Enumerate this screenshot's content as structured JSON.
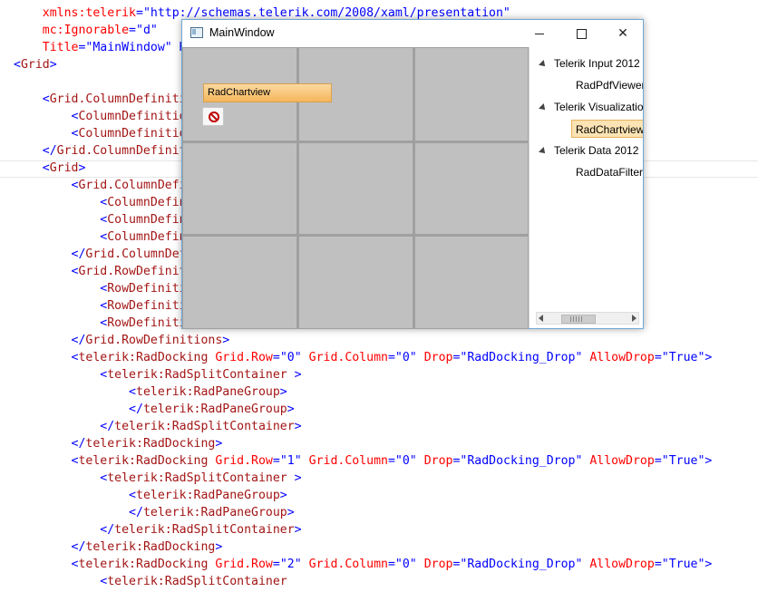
{
  "code_lines": [
    [
      {
        "t": "    "
      },
      {
        "c": "attr",
        "t": "xmlns:telerik"
      },
      {
        "c": "punc",
        "t": "="
      },
      {
        "c": "val",
        "t": "\"http://schemas.telerik.com/2008/xaml/presentation\""
      }
    ],
    [
      {
        "t": "    "
      },
      {
        "c": "attr",
        "t": "mc:Ignorable"
      },
      {
        "c": "punc",
        "t": "="
      },
      {
        "c": "val",
        "t": "\"d\""
      }
    ],
    [
      {
        "t": "    "
      },
      {
        "c": "attr",
        "t": "Title"
      },
      {
        "c": "punc",
        "t": "="
      },
      {
        "c": "val",
        "t": "\"MainWindow\" H"
      }
    ],
    [
      {
        "c": "punc",
        "t": "<"
      },
      {
        "c": "tag",
        "t": "Grid"
      },
      {
        "c": "punc",
        "t": ">"
      }
    ],
    [
      {
        "t": ""
      }
    ],
    [
      {
        "t": "    "
      },
      {
        "c": "punc",
        "t": "<"
      },
      {
        "c": "tag",
        "t": "Grid.ColumnDefinitions>"
      }
    ],
    [
      {
        "t": "        "
      },
      {
        "c": "punc",
        "t": "<"
      },
      {
        "c": "tag",
        "t": "ColumnDefinition"
      }
    ],
    [
      {
        "t": "        "
      },
      {
        "c": "punc",
        "t": "<"
      },
      {
        "c": "tag",
        "t": "ColumnDefinition"
      }
    ],
    [
      {
        "t": "    "
      },
      {
        "c": "punc",
        "t": "</"
      },
      {
        "c": "tag",
        "t": "Grid.ColumnDefinitions>"
      }
    ],
    [
      {
        "t": "    "
      },
      {
        "c": "punc",
        "t": "<"
      },
      {
        "c": "tag",
        "t": "Grid"
      },
      {
        "c": "punc",
        "t": ">"
      }
    ],
    [
      {
        "t": "        "
      },
      {
        "c": "punc",
        "t": "<"
      },
      {
        "c": "tag",
        "t": "Grid.ColumnDefinitions"
      }
    ],
    [
      {
        "t": "            "
      },
      {
        "c": "punc",
        "t": "<"
      },
      {
        "c": "tag",
        "t": "ColumnDefinition"
      }
    ],
    [
      {
        "t": "            "
      },
      {
        "c": "punc",
        "t": "<"
      },
      {
        "c": "tag",
        "t": "ColumnDefinition"
      }
    ],
    [
      {
        "t": "            "
      },
      {
        "c": "punc",
        "t": "<"
      },
      {
        "c": "tag",
        "t": "ColumnDefinition"
      }
    ],
    [
      {
        "t": "        "
      },
      {
        "c": "punc",
        "t": "</"
      },
      {
        "c": "tag",
        "t": "Grid.ColumnDefinitions"
      }
    ],
    [
      {
        "t": "        "
      },
      {
        "c": "punc",
        "t": "<"
      },
      {
        "c": "tag",
        "t": "Grid.RowDefinitions"
      }
    ],
    [
      {
        "t": "            "
      },
      {
        "c": "punc",
        "t": "<"
      },
      {
        "c": "tag",
        "t": "RowDefinition"
      }
    ],
    [
      {
        "t": "            "
      },
      {
        "c": "punc",
        "t": "<"
      },
      {
        "c": "tag",
        "t": "RowDefinition"
      }
    ],
    [
      {
        "t": "            "
      },
      {
        "c": "punc",
        "t": "<"
      },
      {
        "c": "tag",
        "t": "RowDefinition"
      }
    ],
    [
      {
        "t": "        "
      },
      {
        "c": "punc",
        "t": "</"
      },
      {
        "c": "tag",
        "t": "Grid.RowDefinitions"
      },
      {
        "c": "punc",
        "t": ">"
      }
    ],
    [
      {
        "t": "        "
      },
      {
        "c": "punc",
        "t": "<"
      },
      {
        "c": "tag",
        "t": "telerik:RadDocking"
      },
      {
        "t": " "
      },
      {
        "c": "attr",
        "t": "Grid.Row"
      },
      {
        "c": "punc",
        "t": "="
      },
      {
        "c": "val",
        "t": "\"0\""
      },
      {
        "t": " "
      },
      {
        "c": "attr",
        "t": "Grid.Column"
      },
      {
        "c": "punc",
        "t": "="
      },
      {
        "c": "val",
        "t": "\"0\""
      },
      {
        "t": " "
      },
      {
        "c": "attr",
        "t": "Drop"
      },
      {
        "c": "punc",
        "t": "="
      },
      {
        "c": "val",
        "t": "\"RadDocking_Drop\""
      },
      {
        "t": " "
      },
      {
        "c": "attr",
        "t": "AllowDrop"
      },
      {
        "c": "punc",
        "t": "="
      },
      {
        "c": "val",
        "t": "\"True\""
      },
      {
        "c": "punc",
        "t": ">"
      }
    ],
    [
      {
        "t": "            "
      },
      {
        "c": "punc",
        "t": "<"
      },
      {
        "c": "tag",
        "t": "telerik:RadSplitContainer"
      },
      {
        "c": "punc",
        "t": " >"
      }
    ],
    [
      {
        "t": "                "
      },
      {
        "c": "punc",
        "t": "<"
      },
      {
        "c": "tag",
        "t": "telerik:RadPaneGroup"
      },
      {
        "c": "punc",
        "t": ">"
      }
    ],
    [
      {
        "t": "                "
      },
      {
        "c": "punc",
        "t": "</"
      },
      {
        "c": "tag",
        "t": "telerik:RadPaneGroup"
      },
      {
        "c": "punc",
        "t": ">"
      }
    ],
    [
      {
        "t": "            "
      },
      {
        "c": "punc",
        "t": "</"
      },
      {
        "c": "tag",
        "t": "telerik:RadSplitContainer"
      },
      {
        "c": "punc",
        "t": ">"
      }
    ],
    [
      {
        "t": "        "
      },
      {
        "c": "punc",
        "t": "</"
      },
      {
        "c": "tag",
        "t": "telerik:RadDocking"
      },
      {
        "c": "punc",
        "t": ">"
      }
    ],
    [
      {
        "t": "        "
      },
      {
        "c": "punc",
        "t": "<"
      },
      {
        "c": "tag",
        "t": "telerik:RadDocking"
      },
      {
        "t": " "
      },
      {
        "c": "attr",
        "t": "Grid.Row"
      },
      {
        "c": "punc",
        "t": "="
      },
      {
        "c": "val",
        "t": "\"1\""
      },
      {
        "t": " "
      },
      {
        "c": "attr",
        "t": "Grid.Column"
      },
      {
        "c": "punc",
        "t": "="
      },
      {
        "c": "val",
        "t": "\"0\""
      },
      {
        "t": " "
      },
      {
        "c": "attr",
        "t": "Drop"
      },
      {
        "c": "punc",
        "t": "="
      },
      {
        "c": "val",
        "t": "\"RadDocking_Drop\""
      },
      {
        "t": " "
      },
      {
        "c": "attr",
        "t": "AllowDrop"
      },
      {
        "c": "punc",
        "t": "="
      },
      {
        "c": "val",
        "t": "\"True\""
      },
      {
        "c": "punc",
        "t": ">"
      }
    ],
    [
      {
        "t": "            "
      },
      {
        "c": "punc",
        "t": "<"
      },
      {
        "c": "tag",
        "t": "telerik:RadSplitContainer"
      },
      {
        "c": "punc",
        "t": " >"
      }
    ],
    [
      {
        "t": "                "
      },
      {
        "c": "punc",
        "t": "<"
      },
      {
        "c": "tag",
        "t": "telerik:RadPaneGroup"
      },
      {
        "c": "punc",
        "t": ">"
      }
    ],
    [
      {
        "t": "                "
      },
      {
        "c": "punc",
        "t": "</"
      },
      {
        "c": "tag",
        "t": "telerik:RadPaneGroup"
      },
      {
        "c": "punc",
        "t": ">"
      }
    ],
    [
      {
        "t": "            "
      },
      {
        "c": "punc",
        "t": "</"
      },
      {
        "c": "tag",
        "t": "telerik:RadSplitContainer"
      },
      {
        "c": "punc",
        "t": ">"
      }
    ],
    [
      {
        "t": "        "
      },
      {
        "c": "punc",
        "t": "</"
      },
      {
        "c": "tag",
        "t": "telerik:RadDocking"
      },
      {
        "c": "punc",
        "t": ">"
      }
    ],
    [
      {
        "t": "        "
      },
      {
        "c": "punc",
        "t": "<"
      },
      {
        "c": "tag",
        "t": "telerik:RadDocking"
      },
      {
        "t": " "
      },
      {
        "c": "attr",
        "t": "Grid.Row"
      },
      {
        "c": "punc",
        "t": "="
      },
      {
        "c": "val",
        "t": "\"2\""
      },
      {
        "t": " "
      },
      {
        "c": "attr",
        "t": "Grid.Column"
      },
      {
        "c": "punc",
        "t": "="
      },
      {
        "c": "val",
        "t": "\"0\""
      },
      {
        "t": " "
      },
      {
        "c": "attr",
        "t": "Drop"
      },
      {
        "c": "punc",
        "t": "="
      },
      {
        "c": "val",
        "t": "\"RadDocking_Drop\""
      },
      {
        "t": " "
      },
      {
        "c": "attr",
        "t": "AllowDrop"
      },
      {
        "c": "punc",
        "t": "="
      },
      {
        "c": "val",
        "t": "\"True\""
      },
      {
        "c": "punc",
        "t": ">"
      }
    ],
    [
      {
        "t": "            "
      },
      {
        "c": "punc",
        "t": "<"
      },
      {
        "c": "tag",
        "t": "telerik:RadSplitContainer"
      }
    ]
  ],
  "window": {
    "title": "MainWindow",
    "icon": "app-window-icon",
    "minimize": "minimize-icon",
    "maximize": "maximize-icon",
    "close_label": "✕"
  },
  "drag": {
    "label": "RadChartview",
    "cursor": "no-drop-icon"
  },
  "tree": {
    "items": [
      {
        "label": "Telerik Input 2012",
        "level": 0,
        "expanded": true,
        "selected": false
      },
      {
        "label": "RadPdfViewer",
        "level": 1,
        "expanded": false,
        "selected": false
      },
      {
        "label": "Telerik Visualization",
        "level": 0,
        "expanded": true,
        "selected": false
      },
      {
        "label": "RadChartview",
        "level": 1,
        "expanded": false,
        "selected": true
      },
      {
        "label": "Telerik Data 2012",
        "level": 0,
        "expanded": true,
        "selected": false
      },
      {
        "label": "RadDataFilter",
        "level": 1,
        "expanded": false,
        "selected": false
      }
    ]
  },
  "colors": {
    "tag": "#a31515",
    "attribute": "#ff0000",
    "value": "#0000ff",
    "selection": "#fbe3b3"
  }
}
